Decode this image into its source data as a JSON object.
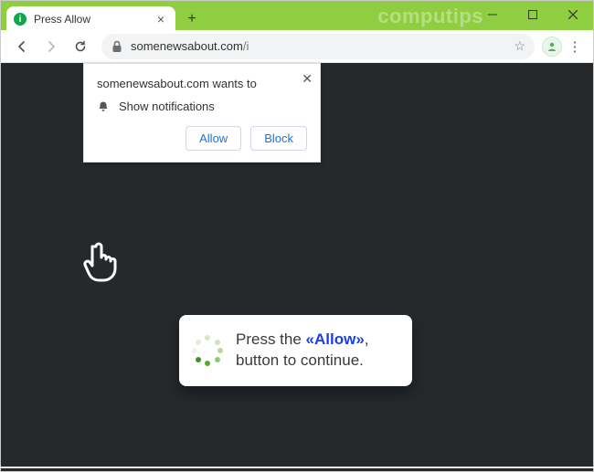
{
  "colors": {
    "accent": "#8fce41",
    "link": "#1a73e8",
    "strong_blue": "#1a3ee8",
    "content_bg": "#25292c"
  },
  "titlebar": {
    "watermark": "computips",
    "tab": {
      "title": "Press Allow",
      "close_glyph": "×"
    },
    "new_tab_glyph": "+",
    "win": {
      "min": "—",
      "max": "▢",
      "close": "✕"
    }
  },
  "toolbar": {
    "back_glyph": "←",
    "forward_glyph": "→",
    "reload_glyph": "⟳",
    "url_host": "somenewsabout.com",
    "url_path": "/i",
    "star_glyph": "☆",
    "avatar_glyph": "🧑",
    "menu_glyph": "⋮"
  },
  "permission": {
    "title": "somenewsabout.com wants to",
    "item": "Show notifications",
    "bell_glyph": "🔔",
    "close_glyph": "✕",
    "allow": "Allow",
    "block": "Block"
  },
  "press": {
    "line1_prefix": "Press the ",
    "line1_strong": "«Allow»",
    "line1_suffix": ",",
    "line2": "button to continue."
  }
}
